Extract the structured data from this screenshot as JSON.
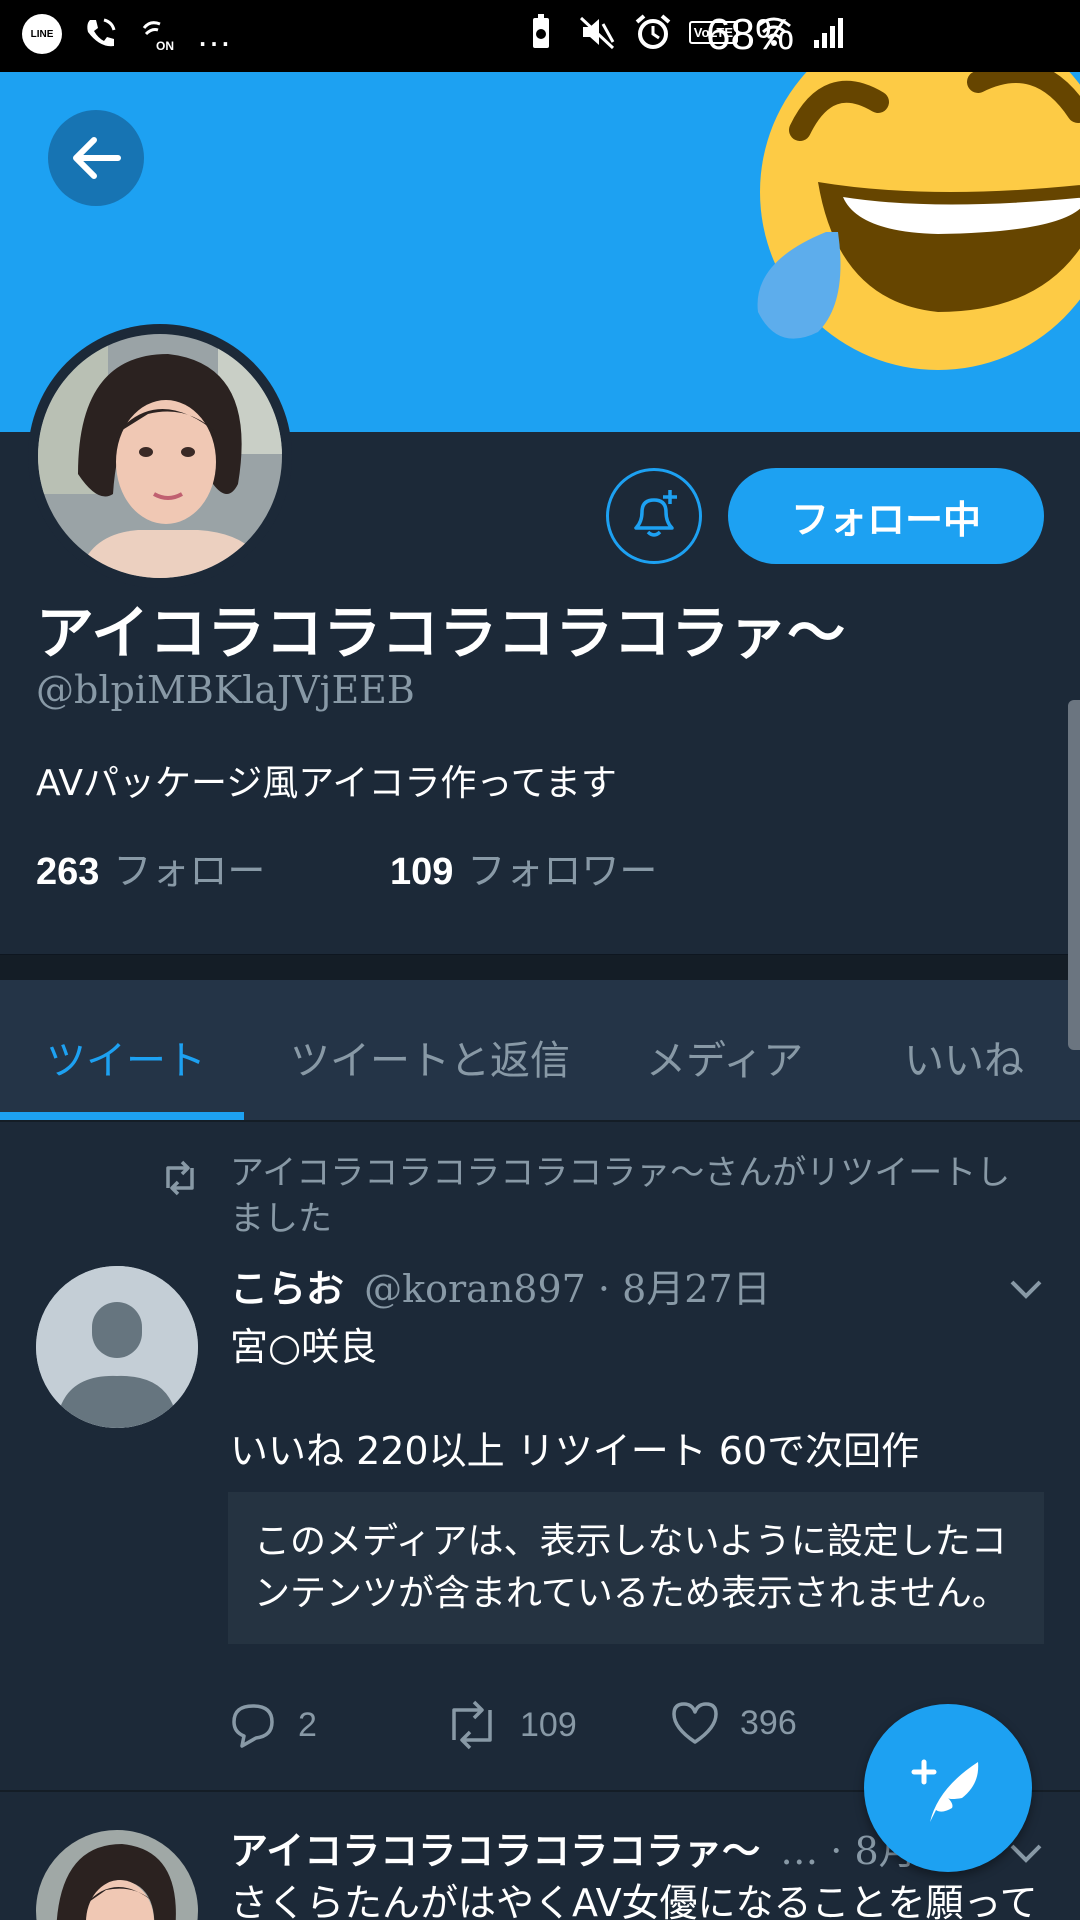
{
  "status_bar": {
    "line_label": "LINE",
    "overflow": "…",
    "volte": "VoLTE",
    "battery": "68%"
  },
  "profile": {
    "display_name": "アイコラコラコラコラコラァ〜",
    "handle": "@blpiMBKlaJVjEEB",
    "bio": "AVパッケージ風アイコラ作ってます",
    "following_count": "263",
    "following_label": "フォロー",
    "followers_count": "109",
    "followers_label": "フォロワー",
    "follow_button": "フォロー中"
  },
  "tabs": [
    {
      "label": "ツイート",
      "active": true
    },
    {
      "label": "ツイートと返信",
      "active": false
    },
    {
      "label": "メディア",
      "active": false
    },
    {
      "label": "いいね",
      "active": false
    }
  ],
  "tweets": [
    {
      "retweet_label": "アイコラコラコラコラコラァ〜さんがリツイートしました",
      "name": "こらお",
      "meta": "@koran897 · 8月27日",
      "line1": "宮○咲良",
      "line2": "いいね 220以上 リツイート 60で次回作",
      "media_notice": "このメディアは、表示しないように設定したコンテンツが含まれているため表示されません。",
      "replies": "2",
      "retweets": "109",
      "likes": "396"
    },
    {
      "name": "アイコラコラコラコラコラァ〜",
      "meta": "… · 8月",
      "text": "さくらたんがはやくAV女優になることを願って"
    }
  ],
  "colors": {
    "accent": "#1da1f2",
    "background": "#1c2938",
    "tab_bar": "#243447",
    "muted_text": "#8899a6"
  }
}
